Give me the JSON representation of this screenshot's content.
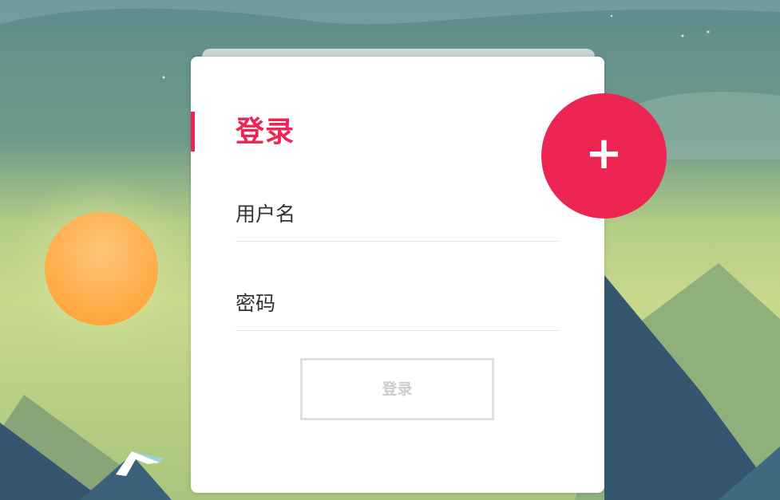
{
  "login": {
    "title": "登录",
    "username_label": "用户名",
    "password_label": "密码",
    "submit_label": "登录"
  },
  "fab": {
    "icon": "plus-icon",
    "symbol": "+"
  },
  "colors": {
    "accent": "#ed2553",
    "sky_top": "#5f8f8e",
    "sky_glow": "#c8d98c",
    "sun": "#ffb454",
    "mountain_dark": "#34566f",
    "mountain_green": "#8fb07a"
  }
}
